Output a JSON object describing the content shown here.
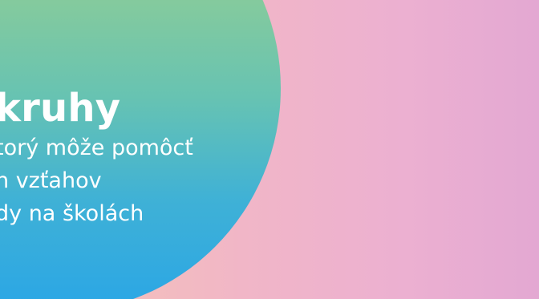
{
  "banner": {
    "title": "kruhy",
    "lines": [
      "torý môže pomôcť",
      "n vzťahov",
      "dy na školách"
    ]
  }
}
